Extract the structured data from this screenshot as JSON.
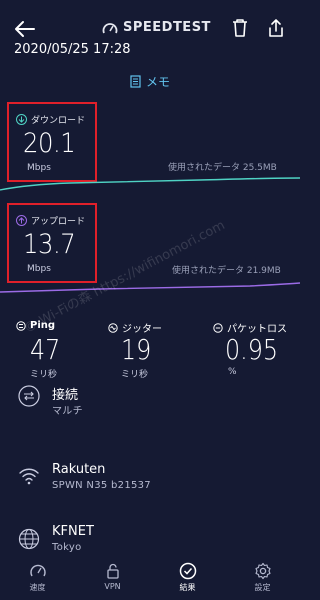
{
  "header": {
    "logo_text": "SPEEDTEST",
    "datetime": "2020/05/25 17:28",
    "memo_label": "メモ"
  },
  "download": {
    "label": "ダウンロード",
    "value": "20.1",
    "unit": "Mbps",
    "data_used": "使用されたデータ 25.5MB",
    "color": "#4fd3c4"
  },
  "upload": {
    "label": "アップロード",
    "value": "13.7",
    "unit": "Mbps",
    "data_used": "使用されたデータ 21.9MB",
    "color": "#9b6be6"
  },
  "stats": {
    "ping": {
      "label": "Ping",
      "value": "47",
      "unit": "ミリ秒"
    },
    "jitter": {
      "label": "ジッター",
      "value": "19",
      "unit": "ミリ秒"
    },
    "packet_loss": {
      "label": "パケットロス",
      "value": "0.95",
      "unit": "%"
    }
  },
  "info": [
    {
      "icon": "connection-icon",
      "title": "接続",
      "sub": "マルチ"
    },
    {
      "icon": "wifi-icon",
      "title": "Rakuten",
      "sub": "SPWN  N35  b21537"
    },
    {
      "icon": "globe-icon",
      "title": "KFNET",
      "sub": "Tokyo"
    }
  ],
  "nav": [
    {
      "icon": "speedometer-icon",
      "label": "速度"
    },
    {
      "icon": "lock-icon",
      "label": "VPN"
    },
    {
      "icon": "results-check-icon",
      "label": "結果"
    },
    {
      "icon": "settings-gear-icon",
      "label": "設定"
    }
  ],
  "watermark": "© Wi-Fiの森 https://wifinomori.com"
}
